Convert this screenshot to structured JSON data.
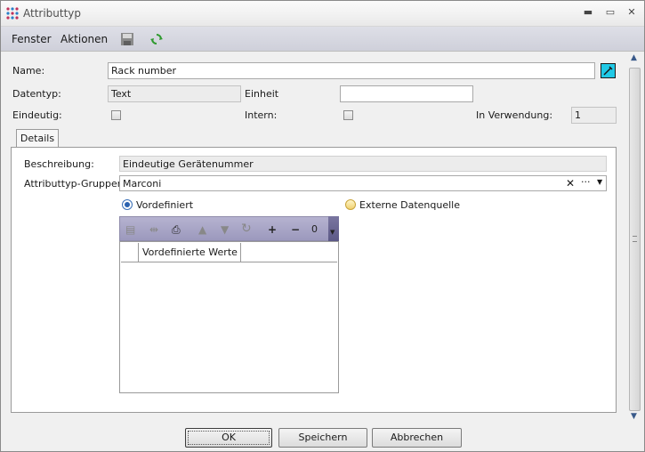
{
  "window": {
    "title": "Attributtyp"
  },
  "menu": {
    "fenster": "Fenster",
    "aktionen": "Aktionen"
  },
  "form": {
    "name_label": "Name:",
    "name_value": "Rack number",
    "datentyp_label": "Datentyp:",
    "datentyp_value": "Text",
    "einheit_label": "Einheit",
    "einheit_value": "",
    "eindeutig_label": "Eindeutig:",
    "eindeutig_checked": false,
    "intern_label": "Intern:",
    "intern_checked": false,
    "in_verwendung_label": "In Verwendung:",
    "in_verwendung_value": "1"
  },
  "tabs": [
    {
      "label": "Details"
    }
  ],
  "details": {
    "beschreibung_label": "Beschreibung:",
    "beschreibung_value": "Eindeutige Gerätenummer",
    "gruppen_label": "Attributtyp-Gruppen:",
    "gruppen_value": "Marconi",
    "radio_vordefiniert": "Vordefiniert",
    "radio_extern": "Externe Datenquelle",
    "selected_source": "Vordefiniert",
    "grid_counter": "0",
    "grid_columns": [
      "",
      "Vordefinierte Werte",
      ""
    ]
  },
  "buttons": {
    "ok": "OK",
    "speichern": "Speichern",
    "abbrechen": "Abbrechen"
  },
  "colors": {
    "pick_button": "#21c9e6",
    "grid_toolbar": "#a9a6c8",
    "menubar": "#d6d7e0"
  }
}
